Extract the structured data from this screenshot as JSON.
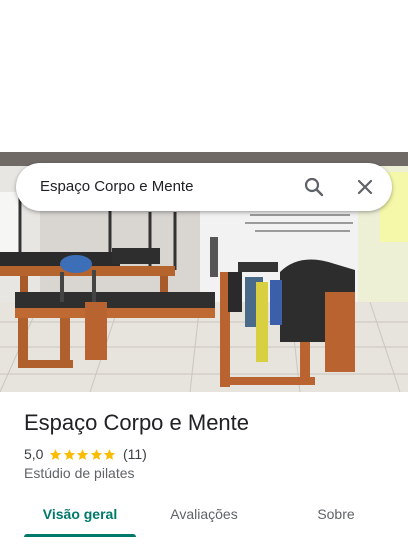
{
  "search": {
    "query": "Espaço Corpo e Mente",
    "search_icon": "search-icon",
    "close_icon": "close-icon"
  },
  "place": {
    "photo_description_icon": "studio-photo",
    "name": "Espaço Corpo e Mente",
    "rating": "5,0",
    "stars": 5,
    "review_count": "(11)",
    "category": "Estúdio de pilates",
    "star_color": "#fbbc04"
  },
  "tabs": [
    {
      "label": "Visão geral",
      "active": true
    },
    {
      "label": "Avaliações",
      "active": false
    },
    {
      "label": "Sobre",
      "active": false
    }
  ],
  "colors": {
    "accent": "#00796b",
    "text_primary": "#202124",
    "text_secondary": "#5f6368"
  }
}
